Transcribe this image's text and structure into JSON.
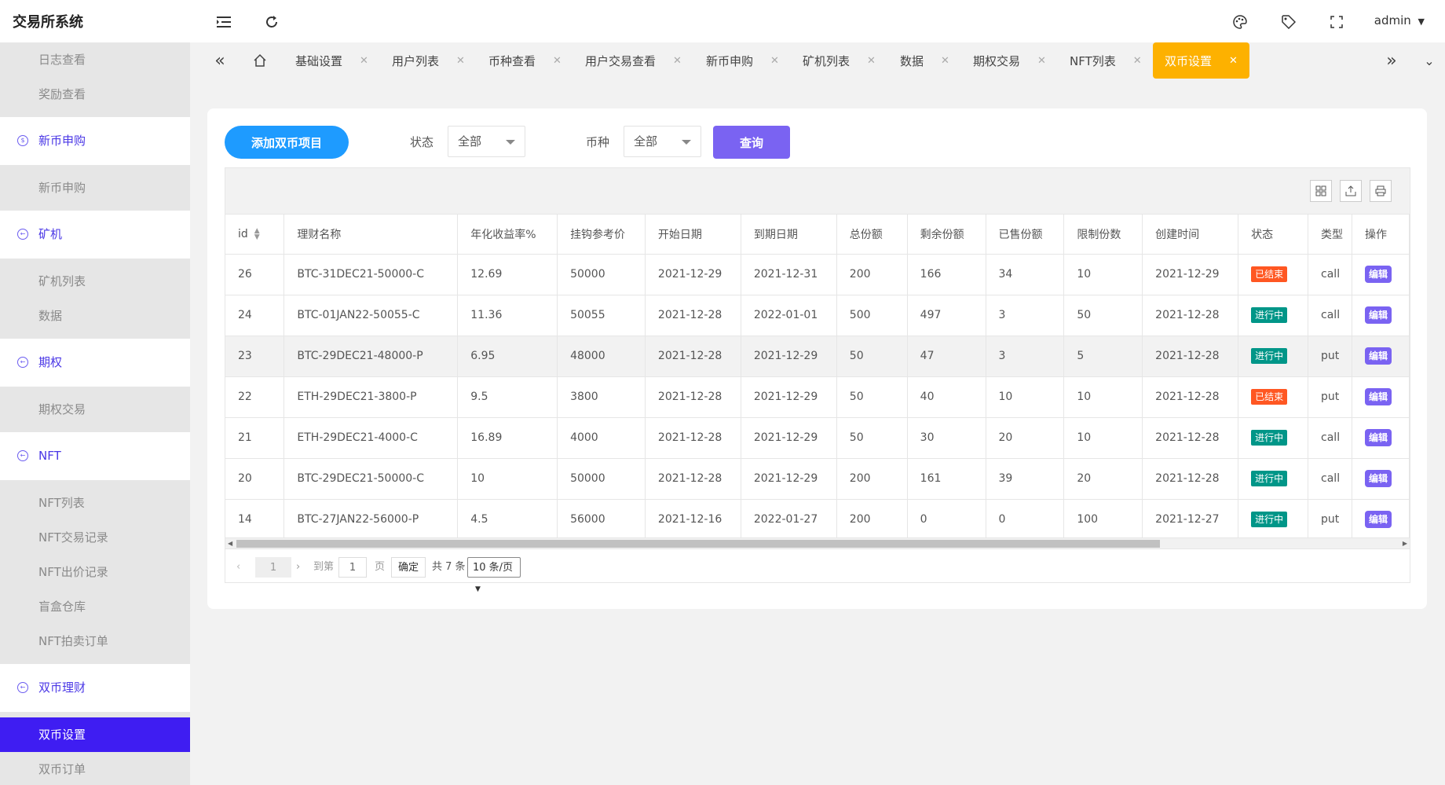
{
  "app": {
    "title": "交易所系统"
  },
  "header": {
    "user": "admin"
  },
  "sidebar": {
    "top_items": [
      "日志查看",
      "奖励查看"
    ],
    "groups": [
      {
        "label": "新币申购",
        "icon": "dollar-circle-icon",
        "items": [
          "新币申购"
        ]
      },
      {
        "label": "矿机",
        "icon": "arrow-circle-icon",
        "items": [
          "矿机列表",
          "数据"
        ]
      },
      {
        "label": "期权",
        "icon": "arrow-circle-icon",
        "items": [
          "期权交易"
        ]
      },
      {
        "label": "NFT",
        "icon": "arrow-circle-icon",
        "items": [
          "NFT列表",
          "NFT交易记录",
          "NFT出价记录",
          "盲盒仓库",
          "NFT拍卖订单"
        ]
      },
      {
        "label": "双币理财",
        "icon": "arrow-circle-icon",
        "items": [
          "双币设置",
          "双币订单"
        ]
      }
    ],
    "active_item": "双币设置"
  },
  "tabs": [
    "基础设置",
    "用户列表",
    "币种查看",
    "用户交易查看",
    "新币申购",
    "矿机列表",
    "数据",
    "期权交易",
    "NFT列表",
    "双币设置"
  ],
  "active_tab": "双币设置",
  "filters": {
    "add_button": "添加双币项目",
    "status_label": "状态",
    "status_value": "全部",
    "coin_label": "币种",
    "coin_value": "全部",
    "query_button": "查询"
  },
  "table": {
    "columns": [
      "id",
      "理财名称",
      "年化收益率%",
      "挂钩参考价",
      "开始日期",
      "到期日期",
      "总份额",
      "剩余份额",
      "已售份额",
      "限制份数",
      "创建时间",
      "状态",
      "类型",
      "操作"
    ],
    "rows": [
      [
        "26",
        "BTC-31DEC21-50000-C",
        "12.69",
        "50000",
        "2021-12-29",
        "2021-12-31",
        "200",
        "166",
        "34",
        "10",
        "2021-12-29",
        "已结束",
        "call",
        "编辑"
      ],
      [
        "24",
        "BTC-01JAN22-50055-C",
        "11.36",
        "50055",
        "2021-12-28",
        "2022-01-01",
        "500",
        "497",
        "3",
        "50",
        "2021-12-28",
        "进行中",
        "call",
        "编辑"
      ],
      [
        "23",
        "BTC-29DEC21-48000-P",
        "6.95",
        "48000",
        "2021-12-28",
        "2021-12-29",
        "50",
        "47",
        "3",
        "5",
        "2021-12-28",
        "进行中",
        "put",
        "编辑"
      ],
      [
        "22",
        "ETH-29DEC21-3800-P",
        "9.5",
        "3800",
        "2021-12-28",
        "2021-12-29",
        "50",
        "40",
        "10",
        "10",
        "2021-12-28",
        "已结束",
        "put",
        "编辑"
      ],
      [
        "21",
        "ETH-29DEC21-4000-C",
        "16.89",
        "4000",
        "2021-12-28",
        "2021-12-29",
        "50",
        "30",
        "20",
        "10",
        "2021-12-28",
        "进行中",
        "call",
        "编辑"
      ],
      [
        "20",
        "BTC-29DEC21-50000-C",
        "10",
        "50000",
        "2021-12-28",
        "2021-12-29",
        "200",
        "161",
        "39",
        "20",
        "2021-12-28",
        "进行中",
        "call",
        "编辑"
      ],
      [
        "14",
        "BTC-27JAN22-56000-P",
        "4.5",
        "56000",
        "2021-12-16",
        "2022-01-27",
        "200",
        "0",
        "0",
        "100",
        "2021-12-27",
        "进行中",
        "put",
        "编辑"
      ]
    ],
    "highlighted_row": 2
  },
  "pager": {
    "current_page": "1",
    "goto_label": "到第",
    "goto_value": "1",
    "page_label": "页",
    "confirm": "确定",
    "total": "共 7 条",
    "page_size": "10 条/页"
  },
  "colors": {
    "accent": "#3f1df2",
    "tab_active": "#fdb100",
    "add_button": "#1e9bff",
    "query_button": "#7a63f2",
    "status_ended": "#ff5722",
    "status_running": "#009688"
  }
}
